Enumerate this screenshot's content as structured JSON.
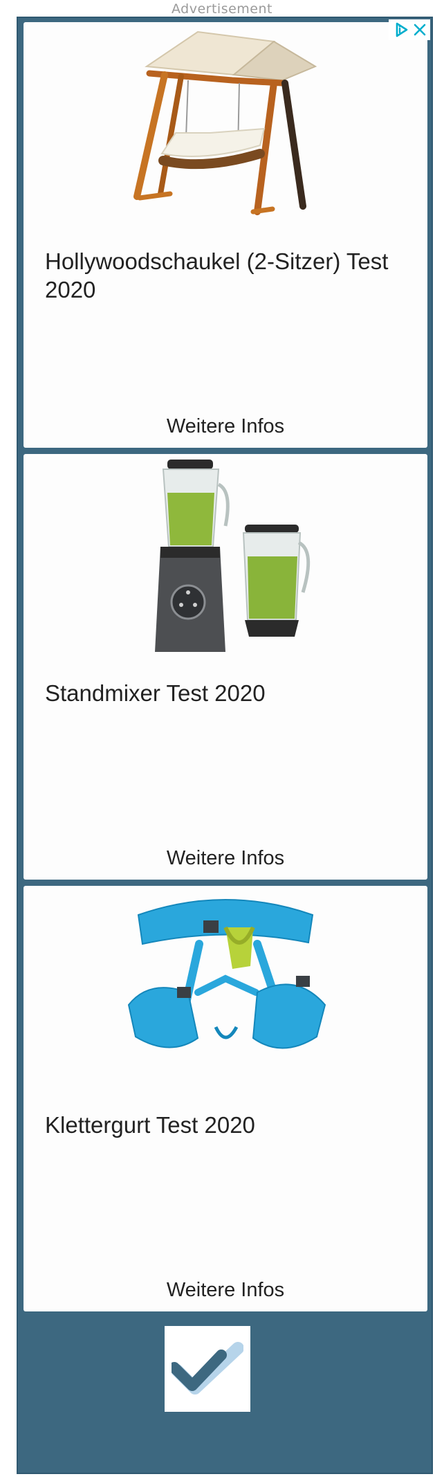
{
  "ad_label": "Advertisement",
  "cards": [
    {
      "title": "Hollywoodschaukel (2-Sitzer) Test 2020",
      "cta": "Weitere Infos"
    },
    {
      "title": "Standmixer Test 2020",
      "cta": "Weitere Infos"
    },
    {
      "title": "Klettergurt Test 2020",
      "cta": "Weitere Infos"
    }
  ],
  "icons": {
    "adchoices": "adchoices-icon",
    "close": "close-icon",
    "logo": "checkmark-logo-icon"
  },
  "colors": {
    "frame": "#3d6880",
    "card": "#fdfdfd",
    "adchoices": "#00aecd",
    "logo_dark": "#3d6880",
    "logo_light": "#a9cde6"
  }
}
